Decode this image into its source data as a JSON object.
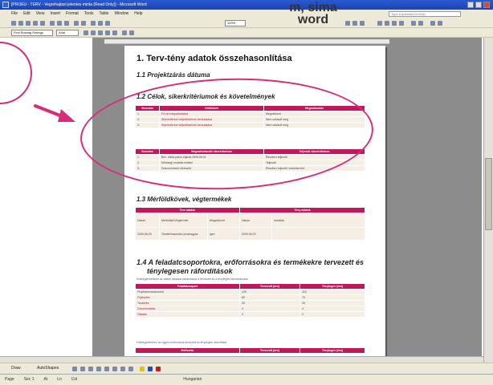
{
  "window": {
    "title": "[PROEU - TERV - Vegrehajtasi jelentes minta (Read Only)] - Microsoft Word",
    "help_placeholder": "Type a question for help"
  },
  "menu": [
    "File",
    "Edit",
    "View",
    "Insert",
    "Format",
    "Tools",
    "Table",
    "Window",
    "Help"
  ],
  "toolbar": {
    "style_value": "First Bowtag Ratings",
    "font_value": "Arial",
    "zoom": "100%"
  },
  "overlay": {
    "line1": "m, sima",
    "line2": "word"
  },
  "document": {
    "h1": "1. Terv-tény adatok összehasonlítása",
    "s11": "1.1  Projektzárás dátuma",
    "s12": "1.2  Célok, sikerkritériumok és követelmények",
    "t1_head": [
      "Sorszám",
      "Célkitűzés",
      "Megvalósulás"
    ],
    "t1_rows": [
      [
        "1.",
        "Fő cél megvalósítása",
        "Megvalósult"
      ],
      [
        "2.",
        "Sikerkritérium teljesítésének bemutatása",
        "Nem valósult meg"
      ],
      [
        "3.",
        "Sikerkritérium teljesítésének bemutatása",
        "Nem valósult meg"
      ]
    ],
    "t2_head": [
      "Sorszám",
      "Megvalósítandó sikerkritérium",
      "Teljesült sikerkritérium"
    ],
    "t2_rows": [
      [
        "1.",
        "Bev. minta páros eljárás 2005.06.01",
        "Részben teljesült"
      ],
      [
        "2.",
        "Minőségi mutatók értékei",
        "Teljesült"
      ],
      [
        "3.",
        "Dokumentáció elkészült",
        "Részben teljesült, indoklás lent"
      ]
    ],
    "s13": "1.3  Mérföldkövek, végtermékek",
    "t3_head": [
      "Terv adatok",
      "Tény adatok"
    ],
    "t3_rows": [
      [
        "Dátum",
        "Mérföldkő/Végtermék",
        "Megvalósult",
        "Dátum",
        "Indoklás"
      ],
      [
        "2005.06.29",
        "Tesztfelhasználói jóváhagyás",
        "igen",
        "2005.06.29",
        ""
      ]
    ],
    "s14_line1": "1.4  A feladatcsoportokra, erőforrásokra és termékekre tervezett és",
    "s14_line2": "ténylegesen ráfordítások",
    "note1": "Költségtervenként az alábbi táblázat tartalmazza a tervezett és a tényleges ráfordításokat",
    "t4_head": [
      "Feladatcsoport",
      "Tervezett (óra)",
      "Tényleges (óra)"
    ],
    "t4_rows": [
      [
        "Projektmenedzsment",
        "120",
        "115"
      ],
      [
        "Fejlesztés",
        "60",
        "70"
      ],
      [
        "Tesztelés",
        "20",
        "20"
      ],
      [
        "Dokumentálás",
        "4",
        "4"
      ],
      [
        "Oktatás",
        "2",
        "2"
      ]
    ],
    "note2": "Költségvetésben az egyes erőforrások tervezett és tényleges ráfordítása",
    "t5_head": [
      "Erőforrás",
      "Tervezett (óra)",
      "Tényleges (óra)"
    ]
  },
  "drawbar": {
    "draw_label": "Draw",
    "autoshapes_label": "AutoShapes"
  },
  "status": {
    "page": "Page",
    "sec": "Sec 1",
    "at": "At",
    "ln": "Ln",
    "col": "Col",
    "lang": "Hungarian"
  },
  "colors": {
    "accent": "#c0185a",
    "annotation": "#d82c7a"
  }
}
